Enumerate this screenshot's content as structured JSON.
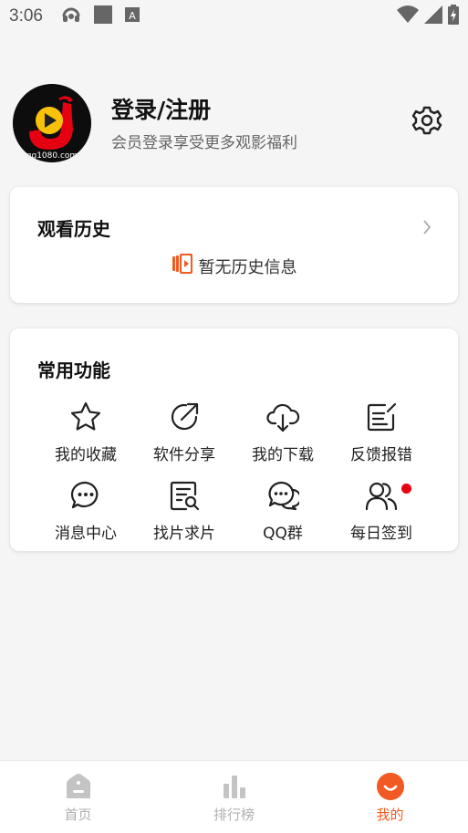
{
  "status_bar": {
    "time": "3:06"
  },
  "profile": {
    "title": "登录/注册",
    "subtitle": "会员登录享受更多观影福利",
    "avatar_text": "gg1080.com"
  },
  "history": {
    "title": "观看历史",
    "empty_text": "暂无历史信息"
  },
  "features": {
    "title": "常用功能",
    "items": [
      {
        "label": "我的收藏",
        "icon": "star-icon"
      },
      {
        "label": "软件分享",
        "icon": "share-icon"
      },
      {
        "label": "我的下载",
        "icon": "cloud-download-icon"
      },
      {
        "label": "反馈报错",
        "icon": "feedback-icon"
      },
      {
        "label": "消息中心",
        "icon": "message-icon"
      },
      {
        "label": "找片求片",
        "icon": "search-doc-icon"
      },
      {
        "label": "QQ群",
        "icon": "chat-bubbles-icon"
      },
      {
        "label": "每日签到",
        "icon": "users-icon"
      }
    ]
  },
  "bottom_nav": {
    "items": [
      {
        "label": "首页",
        "icon": "home-icon"
      },
      {
        "label": "排行榜",
        "icon": "chart-icon"
      },
      {
        "label": "我的",
        "icon": "smile-icon"
      }
    ]
  },
  "colors": {
    "accent": "#f15a22",
    "badge": "#e60012",
    "background": "#f5f5f5"
  }
}
